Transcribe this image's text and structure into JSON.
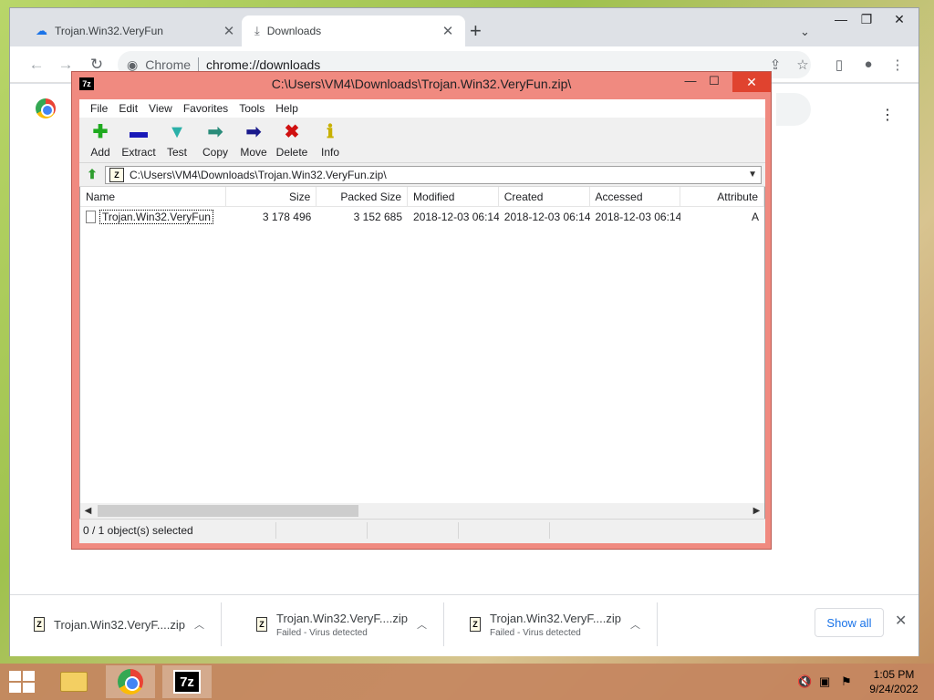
{
  "browser": {
    "tabs": [
      {
        "title": "Trojan.Win32.VeryFun",
        "icon": "cloud-icon",
        "active": false
      },
      {
        "title": "Downloads",
        "icon": "download-icon",
        "active": true
      }
    ],
    "new_tab_symbol": "+",
    "omnibox": {
      "chip": "Chrome",
      "url": "chrome://downloads"
    },
    "download_shelf": {
      "items": [
        {
          "name": "Trojan.Win32.VeryF....zip",
          "status": ""
        },
        {
          "name": "Trojan.Win32.VeryF....zip",
          "status": "Failed - Virus detected"
        },
        {
          "name": "Trojan.Win32.VeryF....zip",
          "status": "Failed - Virus detected"
        }
      ],
      "show_all": "Show all"
    }
  },
  "zip_window": {
    "title": "C:\\Users\\VM4\\Downloads\\Trojan.Win32.VeryFun.zip\\",
    "app_icon_text": "7z",
    "menu": [
      "File",
      "Edit",
      "View",
      "Favorites",
      "Tools",
      "Help"
    ],
    "toolbar": [
      {
        "label": "Add",
        "icon": "plus-icon",
        "glyph": "✚",
        "color": "#1faa1f"
      },
      {
        "label": "Extract",
        "icon": "minus-icon",
        "glyph": "▬",
        "color": "#1a1ab8"
      },
      {
        "label": "Test",
        "icon": "check-down-icon",
        "glyph": "▼",
        "color": "#2bb0a8"
      },
      {
        "label": "Copy",
        "icon": "copy-arrow-icon",
        "glyph": "➡",
        "color": "#2a8c7a"
      },
      {
        "label": "Move",
        "icon": "move-arrow-icon",
        "glyph": "➡",
        "color": "#1a1a8c"
      },
      {
        "label": "Delete",
        "icon": "delete-x-icon",
        "glyph": "✖",
        "color": "#d01010"
      },
      {
        "label": "Info",
        "icon": "info-icon",
        "glyph": "ℹ",
        "color": "#c8b000"
      }
    ],
    "address": "C:\\Users\\VM4\\Downloads\\Trojan.Win32.VeryFun.zip\\",
    "columns": {
      "name": "Name",
      "size": "Size",
      "packed": "Packed Size",
      "modified": "Modified",
      "created": "Created",
      "accessed": "Accessed",
      "attributes": "Attribute"
    },
    "rows": [
      {
        "name": "Trojan.Win32.VeryFun",
        "size": "3 178 496",
        "packed": "3 152 685",
        "modified": "2018-12-03 06:14",
        "created": "2018-12-03 06:14",
        "accessed": "2018-12-03 06:14",
        "attributes": "A"
      }
    ],
    "status": [
      "0 / 1 object(s) selected",
      "",
      "",
      ""
    ]
  },
  "taskbar": {
    "sevenz_label": "7z",
    "clock_time": "1:05 PM",
    "clock_date": "9/24/2022"
  }
}
